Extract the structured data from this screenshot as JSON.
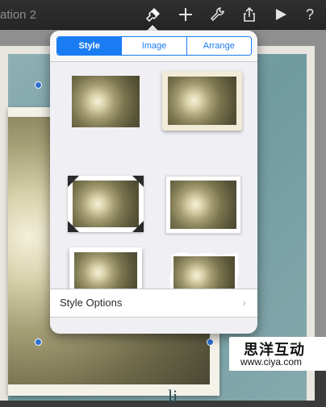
{
  "toolbar": {
    "document_title": "ation 2",
    "icons": [
      "paintbrush-icon",
      "plus-icon",
      "wrench-icon",
      "share-icon",
      "play-icon",
      "help-icon"
    ]
  },
  "popover": {
    "tabs": [
      {
        "label": "Style",
        "selected": true
      },
      {
        "label": "Image",
        "selected": false
      },
      {
        "label": "Arrange",
        "selected": false
      }
    ],
    "style_thumbnails": [
      "plain",
      "cream-mat",
      "corner-mounts",
      "white-border",
      "curled-frame",
      "torn-edges"
    ],
    "style_options_label": "Style Options",
    "chevron": "›"
  },
  "slide": {
    "bottom_text": "li"
  },
  "watermark": {
    "main": "思洋互动",
    "sub": "www.ciya.com"
  },
  "colors": {
    "accent": "#1a7cf3",
    "toolbar_bg": "#2a2a2a",
    "popover_bg": "#efeff4",
    "selection_handle": "#2c6fd1"
  }
}
